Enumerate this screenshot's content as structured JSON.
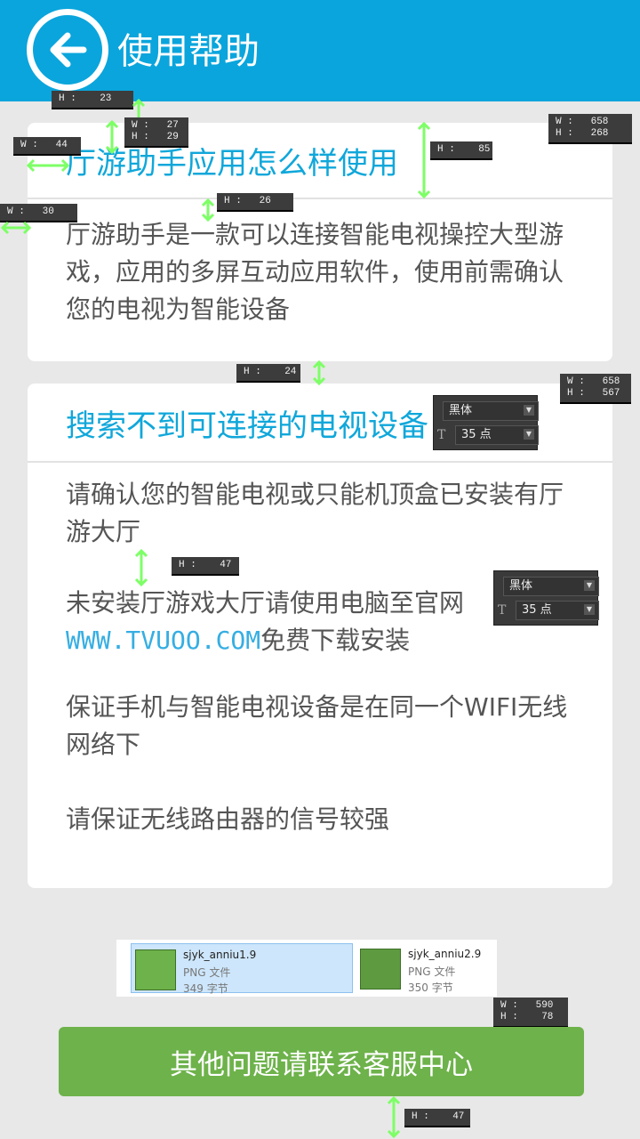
{
  "header": {
    "title": "使用帮助",
    "back_icon": "arrow-left-icon",
    "bg_color": "#0aa5dc"
  },
  "section1": {
    "title": "厅游助手应用怎么样使用",
    "body": "厅游助手是一款可以连接智能电视操控大型游戏，应用的多屏互动应用软件，使用前需确认您的电视为智能设备"
  },
  "section2": {
    "title": "搜索不到可连接的电视设备",
    "p1": "请确认您的智能电视或只能机顶盒已安装有厅游大厅",
    "p2_before": "未安装厅游戏大厅请使用电脑至官网",
    "p2_link": "WWW.TVUOO.COM",
    "p2_after": "免费下载安装",
    "p3": "保证手机与智能电视设备是在同一个WIFI无线网络下",
    "p4": "请保证无线路由器的信号较强"
  },
  "annotations": {
    "m1": "H :    23",
    "m2a": "W :   27",
    "m2b": "H :   29",
    "m3": "W :   44",
    "m4": "H :    85",
    "m5a": "W :   658",
    "m5b": "H :   268",
    "m6": "W :   30",
    "m7": "H :   26",
    "m8": "H :    24",
    "m9a": "W :   658",
    "m9b": "H :   567",
    "m10": "H :    47",
    "m11a": "W :   590",
    "m11b": "H :    78",
    "m12": "H :    47",
    "font_panel_1": {
      "font": "黑体",
      "size": "35 点"
    },
    "font_panel_2": {
      "font": "黑体",
      "size": "35 点"
    }
  },
  "files": [
    {
      "name": "sjyk_anniu1.9",
      "type": "PNG 文件",
      "size": "349 字节",
      "color": "#6db24a"
    },
    {
      "name": "sjyk_anniu2.9",
      "type": "PNG 文件",
      "size": "350 字节",
      "color": "#5e9a40"
    }
  ],
  "contact_button": {
    "label": "其他问题请联系客服中心",
    "color": "#6db24a"
  }
}
